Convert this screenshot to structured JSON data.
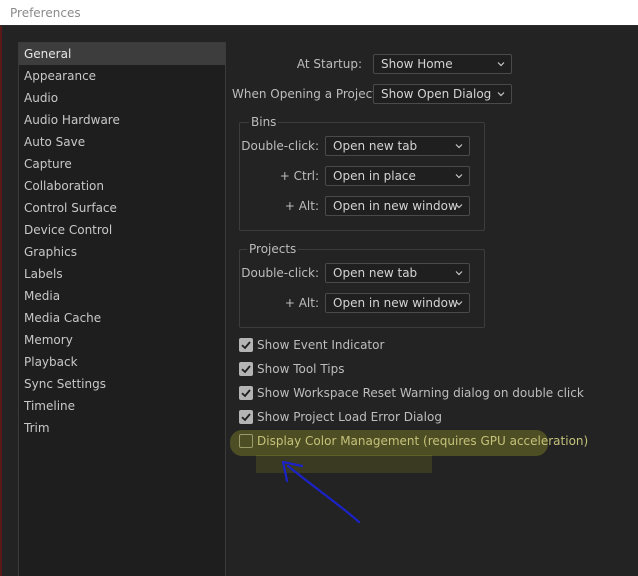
{
  "window": {
    "title": "Preferences"
  },
  "sidebar": {
    "items": [
      {
        "label": "General",
        "selected": true
      },
      {
        "label": "Appearance"
      },
      {
        "label": "Audio"
      },
      {
        "label": "Audio Hardware"
      },
      {
        "label": "Auto Save"
      },
      {
        "label": "Capture"
      },
      {
        "label": "Collaboration"
      },
      {
        "label": "Control Surface"
      },
      {
        "label": "Device Control"
      },
      {
        "label": "Graphics"
      },
      {
        "label": "Labels"
      },
      {
        "label": "Media"
      },
      {
        "label": "Media Cache"
      },
      {
        "label": "Memory"
      },
      {
        "label": "Playback"
      },
      {
        "label": "Sync Settings"
      },
      {
        "label": "Timeline"
      },
      {
        "label": "Trim"
      }
    ]
  },
  "general": {
    "startup": {
      "label": "At Startup:",
      "value": "Show Home"
    },
    "opening_project": {
      "label": "When Opening a Project:",
      "value": "Show Open Dialog"
    },
    "bins": {
      "title": "Bins",
      "double_click": {
        "label": "Double-click:",
        "value": "Open new tab"
      },
      "ctrl": {
        "label": "+ Ctrl:",
        "value": "Open in place"
      },
      "alt": {
        "label": "+ Alt:",
        "value": "Open in new window"
      }
    },
    "projects": {
      "title": "Projects",
      "double_click": {
        "label": "Double-click:",
        "value": "Open new tab"
      },
      "alt": {
        "label": "+ Alt:",
        "value": "Open in new window"
      }
    },
    "checkboxes": [
      {
        "label": "Show Event Indicator",
        "checked": true
      },
      {
        "label": "Show Tool Tips",
        "checked": true
      },
      {
        "label": "Show Workspace Reset Warning dialog on double click",
        "checked": true
      },
      {
        "label": "Show Project Load Error Dialog",
        "checked": true
      },
      {
        "label": "Display Color Management (requires GPU acceleration)",
        "checked": false
      }
    ]
  },
  "colors": {
    "highlight": "#e8e828",
    "annotation_arrow": "#1a22c8"
  }
}
